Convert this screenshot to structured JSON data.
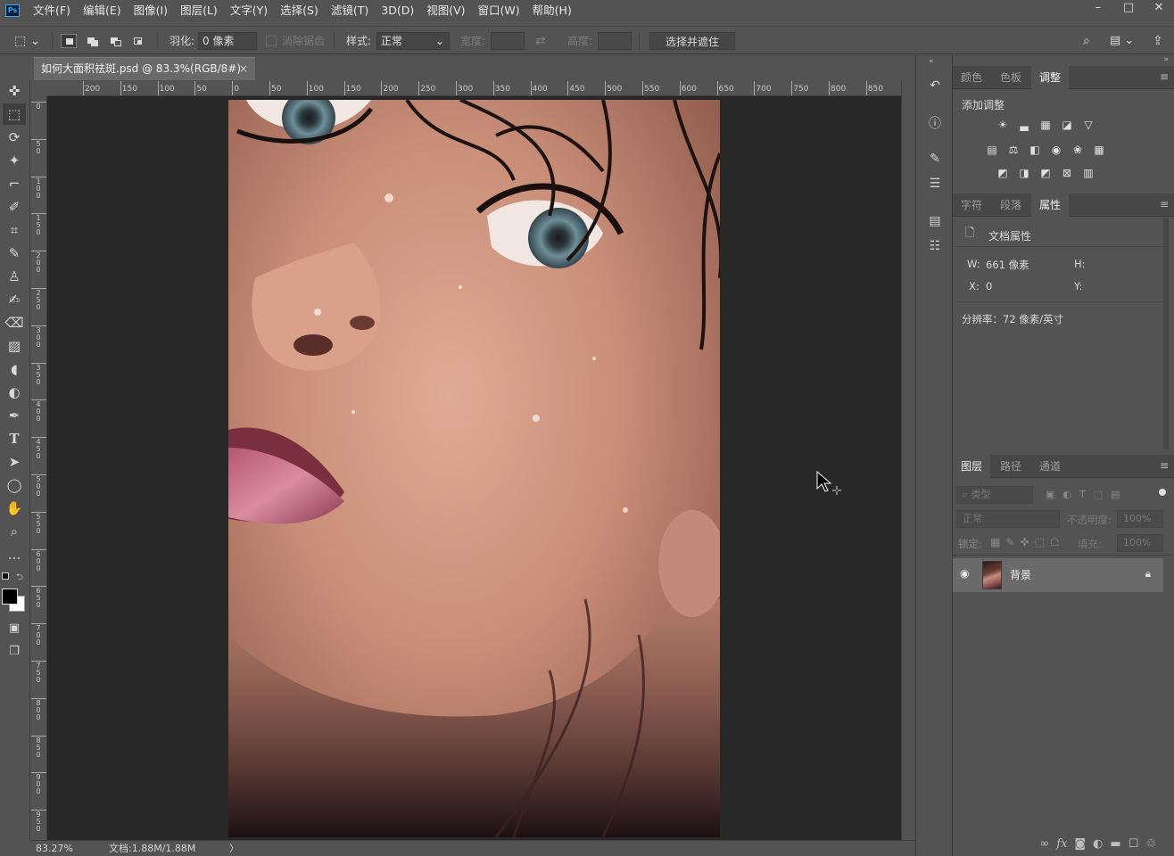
{
  "menubar": {
    "logo": "Ps",
    "items": [
      "文件(F)",
      "编辑(E)",
      "图像(I)",
      "图层(L)",
      "文字(Y)",
      "选择(S)",
      "滤镜(T)",
      "3D(D)",
      "视图(V)",
      "窗口(W)",
      "帮助(H)"
    ],
    "window_controls": [
      "minimize-icon",
      "restore-icon",
      "close-icon"
    ]
  },
  "options": {
    "feather_label": "羽化:",
    "feather_value": "0 像素",
    "antialias_label": "消除锯齿",
    "style_label": "样式:",
    "style_value": "正常",
    "width_label": "宽度:",
    "height_label": "高度:",
    "select_mask_button": "选择并遮住 ..."
  },
  "document": {
    "tab_title": "如何大面积祛斑.psd @ 83.3%(RGB/8#)",
    "close": "×"
  },
  "ruler": {
    "h_labels": [
      "200",
      "150",
      "100",
      "50",
      "0",
      "50",
      "100",
      "150",
      "200",
      "250",
      "300",
      "350",
      "400",
      "450",
      "500",
      "550",
      "600",
      "650",
      "700",
      "750",
      "800",
      "850"
    ],
    "v_labels": [
      "0",
      "50",
      "100",
      "150",
      "200",
      "250",
      "300",
      "350",
      "400",
      "450",
      "500",
      "550",
      "600",
      "650",
      "700",
      "750",
      "800",
      "850",
      "900",
      "950"
    ]
  },
  "status": {
    "zoom": "83.27%",
    "doc_info": "文档:1.88M/1.88M",
    "arrow": "〉"
  },
  "adjust_panel": {
    "tabs": [
      "颜色",
      "色板",
      "调整"
    ],
    "active_tab": "调整",
    "add_adjustment": "添加调整",
    "icons_row1": [
      "brightness-contrast-icon",
      "levels-icon",
      "curves-icon",
      "exposure-icon",
      "vibrance-icon"
    ],
    "icons_row2": [
      "hue-saturation-icon",
      "color-balance-icon",
      "black-white-icon",
      "photo-filter-icon",
      "channel-mixer-icon",
      "color-lookup-icon"
    ],
    "icons_row3": [
      "invert-icon",
      "posterize-icon",
      "threshold-icon",
      "selective-color-icon",
      "gradient-map-icon"
    ]
  },
  "properties_panel": {
    "tabs": [
      "字符",
      "段落",
      "属性"
    ],
    "active_tab": "属性",
    "title": "文档属性",
    "w_label": "W:",
    "w_value": "661 像素",
    "h_label": "H:",
    "x_label": "X:",
    "x_value": "0",
    "y_label": "Y:",
    "resolution": "分辨率：72 像素/英寸"
  },
  "layers_panel": {
    "tabs": [
      "图层",
      "路径",
      "通道"
    ],
    "active_tab": "图层",
    "filter_placeholder": "类型",
    "blend_mode": "正常",
    "opacity_label": "不透明度:",
    "opacity_value": "100%",
    "lock_label": "锁定:",
    "fill_label": "填充:",
    "fill_value": "100%",
    "layers": [
      {
        "name": "背景",
        "visible": true,
        "locked": true
      }
    ],
    "footer_icons": [
      "link-icon",
      "fx-icon",
      "mask-icon",
      "adjustment-layer-icon",
      "group-icon",
      "new-layer-icon",
      "trash-icon"
    ],
    "fx_text": "fx"
  },
  "colors": {
    "accent": "#31a8ff",
    "panel_bg": "#535353",
    "canvas_bg": "#282828"
  }
}
